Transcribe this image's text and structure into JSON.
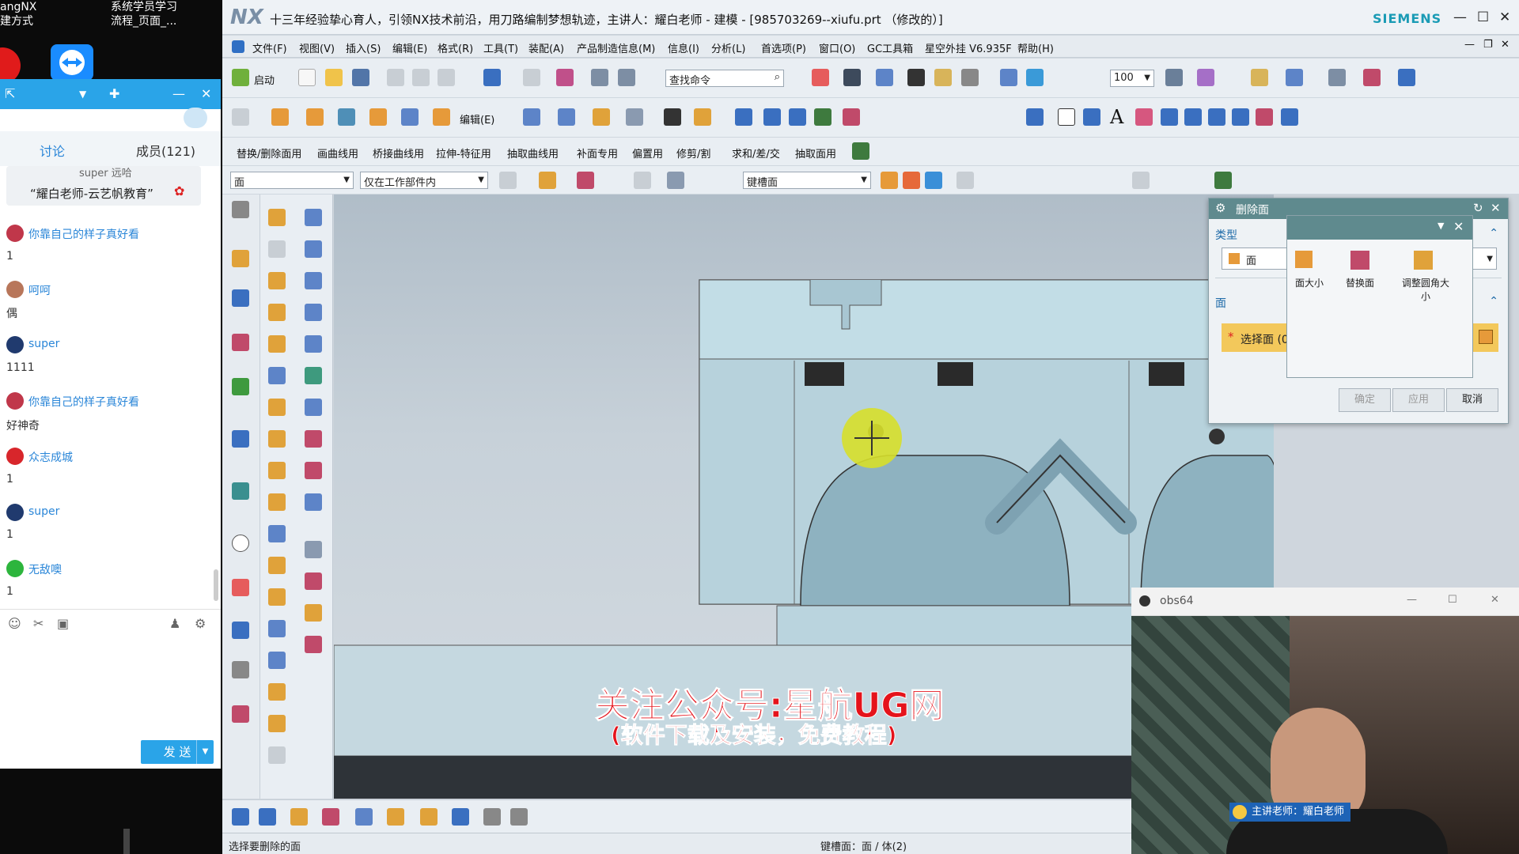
{
  "desktop": {
    "icon1_label_line1": "angNX",
    "icon1_label_line2": "建方式",
    "icon2_label_line1": "系统学员学习",
    "icon2_label_line2": "流程_页面_..."
  },
  "chat": {
    "tabs": [
      "讨论",
      "成员(121)"
    ],
    "pinned_user": "super 远哈",
    "pinned_text": "“耀白老师-云艺帆教育”",
    "messages": [
      {
        "name": "你靠自己的样子真好看",
        "text": "1",
        "color": "#c0374a"
      },
      {
        "name": "呵呵",
        "text": "偶",
        "color": "#b8765a"
      },
      {
        "name": "super",
        "text": "1111",
        "color": "#203a6e"
      },
      {
        "name": "你靠自己的样子真好看",
        "text": "好神奇",
        "color": "#c0374a"
      },
      {
        "name": "众志成城",
        "text": "1",
        "color": "#d8262b"
      },
      {
        "name": "super",
        "text": "1",
        "color": "#203a6e"
      },
      {
        "name": "无敌噢",
        "text": "1",
        "color": "#2db53d"
      }
    ],
    "send_label": "发 送"
  },
  "nx": {
    "logo": "NX",
    "title": "十三年经验挚心育人，引领NX技术前沿，用刀路编制梦想轨迹，主讲人：耀白老师 - 建模 - [985703269--xiufu.prt （修改的）]",
    "brand": "SIEMENS",
    "menu": [
      "文件(F)",
      "视图(V)",
      "插入(S)",
      "编辑(E)",
      "格式(R)",
      "工具(T)",
      "装配(A)",
      "产品制造信息(M)",
      "信息(I)",
      "分析(L)",
      "首选项(P)",
      "窗口(O)",
      "GC工具箱",
      "星空外挂 V6.935F",
      "帮助(H)"
    ],
    "toolbar": {
      "start_label": "启动",
      "find_placeholder": "查找命令",
      "zoom_value": "100",
      "edit_label": "编辑(E)"
    },
    "toolbar3": [
      "替换/删除面用",
      "画曲线用",
      "桥接曲线用",
      "拉伸-特征用",
      "抽取曲线用",
      "补面专用",
      "偏置用",
      "修剪/割",
      "求和/差/交",
      "抽取面用"
    ],
    "filter": {
      "type_value": "面",
      "scope_value": "仅在工作部件内",
      "rule_value": "键槽面"
    },
    "watermark_line1": "关注公众号:星航UG网",
    "watermark_line2": "(软件下载及安装，免费教程)",
    "status_left": "选择要删除的面",
    "status_mid": "键槽面：面 / 体(2)"
  },
  "dialog": {
    "title": "删除面",
    "section_type": "类型",
    "type_value": "面",
    "section_face": "面",
    "select_label": "选择面 (0)",
    "ok": "确定",
    "apply": "应用",
    "cancel": "取消"
  },
  "dialog2": {
    "items": [
      "面大小",
      "替换面",
      "调整圆角大小"
    ]
  },
  "obs": {
    "title": "obs64",
    "caption": "主讲老师：耀白老师"
  }
}
